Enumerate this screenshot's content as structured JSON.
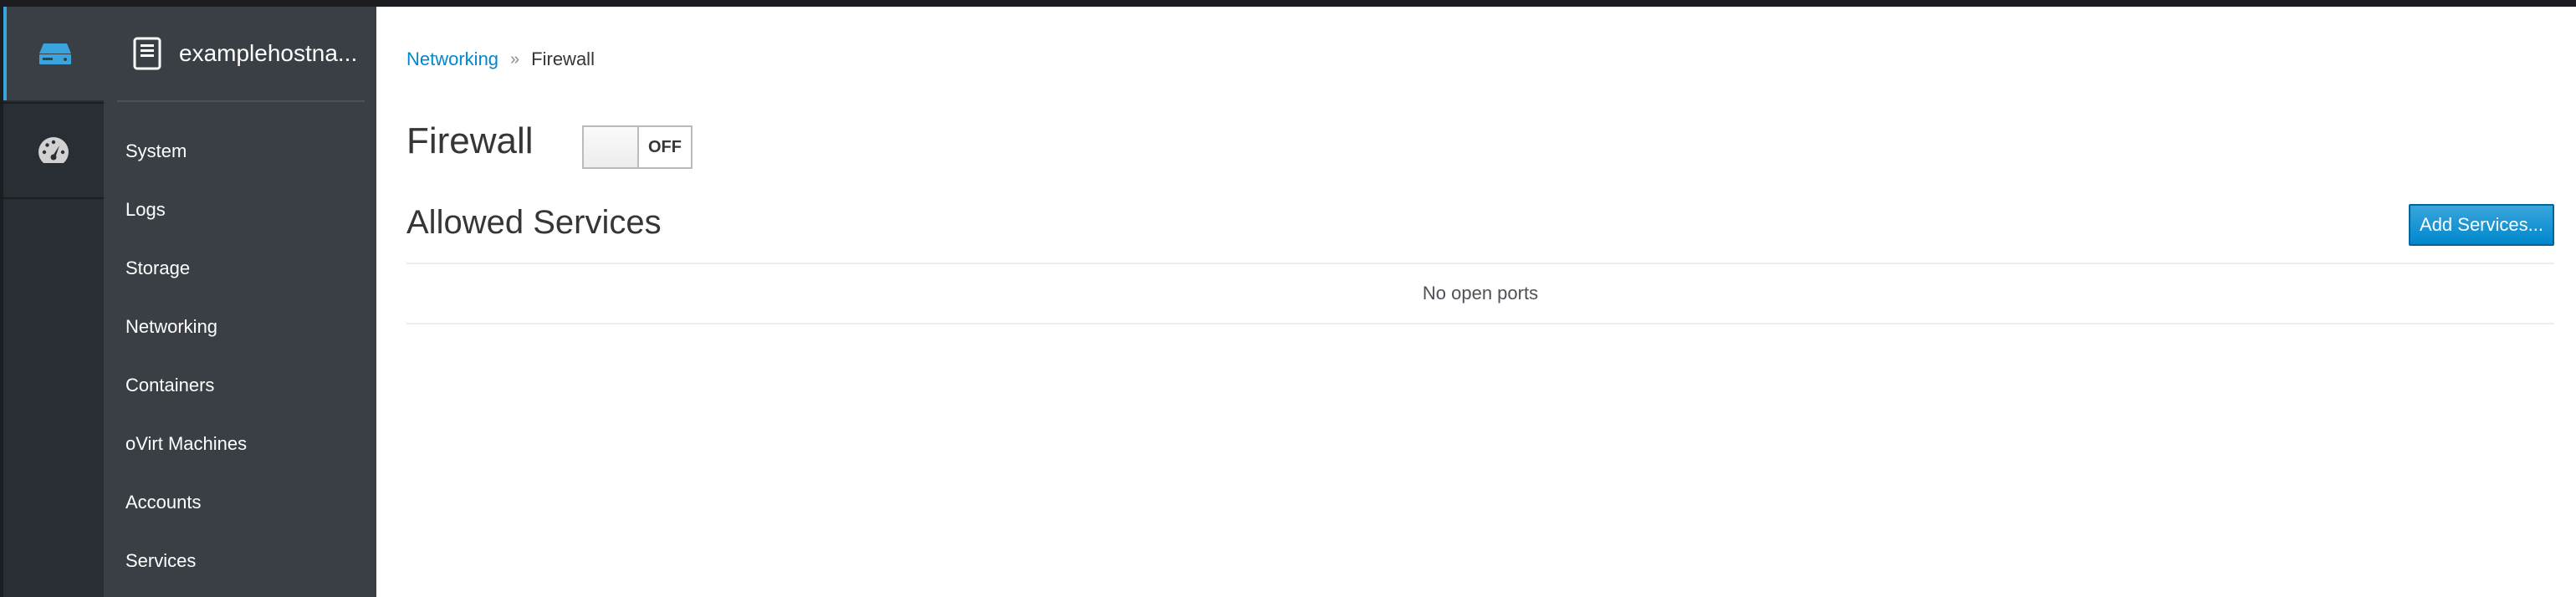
{
  "rail": {
    "items": [
      {
        "icon": "server-icon",
        "active": true
      },
      {
        "icon": "dashboard-icon",
        "active": false
      }
    ]
  },
  "host": {
    "name": "examplehostna..."
  },
  "sidebar": {
    "items": [
      {
        "label": "System"
      },
      {
        "label": "Logs"
      },
      {
        "label": "Storage"
      },
      {
        "label": "Networking"
      },
      {
        "label": "Containers"
      },
      {
        "label": "oVirt Machines"
      },
      {
        "label": "Accounts"
      },
      {
        "label": "Services"
      }
    ]
  },
  "breadcrumb": {
    "parent": "Networking",
    "separator": "»",
    "current": "Firewall"
  },
  "firewall": {
    "title": "Firewall",
    "toggle_state": "OFF"
  },
  "services": {
    "title": "Allowed Services",
    "add_button": "Add Services...",
    "empty_message": "No open ports"
  },
  "colors": {
    "accent": "#0088ce",
    "rail_bg": "#292e34",
    "sidebar_bg": "#393f44",
    "active_indicator": "#39a5dc"
  }
}
